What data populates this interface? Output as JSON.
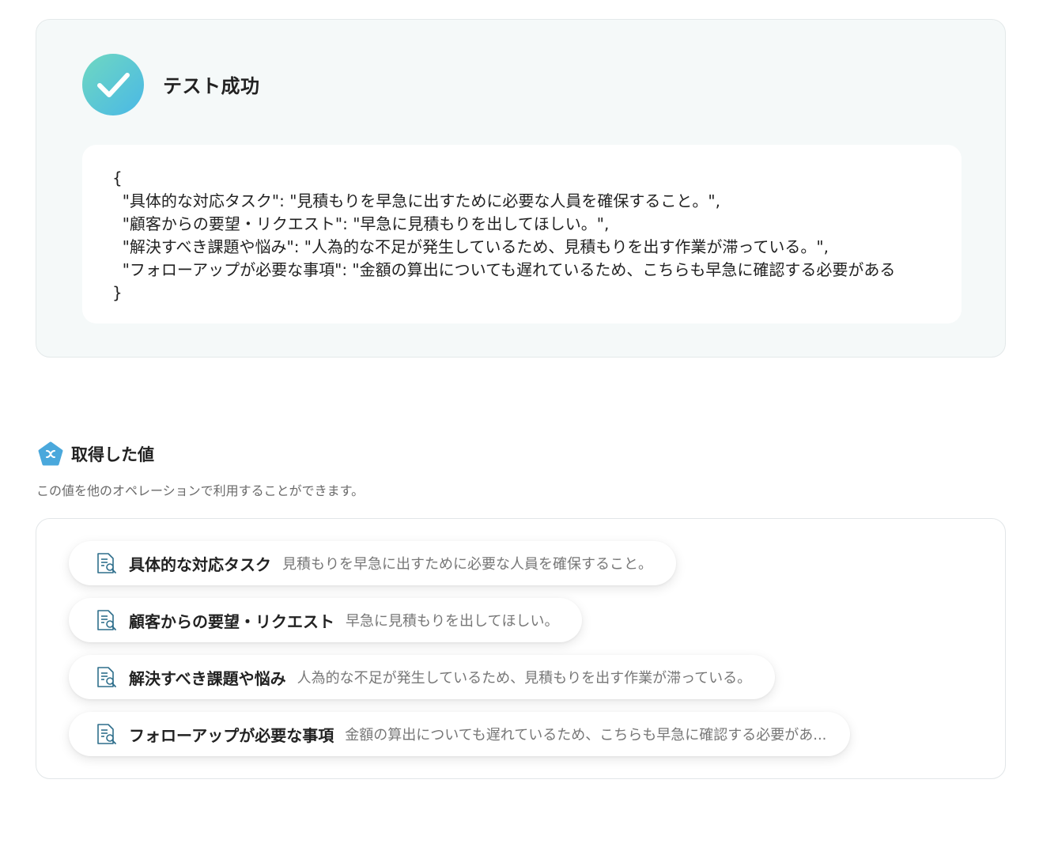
{
  "test_result": {
    "status_label": "テスト成功",
    "json_lines": [
      "{",
      "  \"具体的な対応タスク\": \"見積もりを早急に出すために必要な人員を確保すること。\",",
      "  \"顧客からの要望・リクエスト\": \"早急に見積もりを出してほしい。\",",
      "  \"解決すべき課題や悩み\": \"人為的な不足が発生しているため、見積もりを出す作業が滞っている。\",",
      "  \"フォローアップが必要な事項\": \"金額の算出についても遅れているため、こちらも早急に確認する必要がある",
      "}"
    ]
  },
  "values_section": {
    "title": "取得した値",
    "description": "この値を他のオペレーションで利用することができます。",
    "items": [
      {
        "key": "具体的な対応タスク",
        "value": "見積もりを早急に出すために必要な人員を確保すること。"
      },
      {
        "key": "顧客からの要望・リクエスト",
        "value": "早急に見積もりを出してほしい。"
      },
      {
        "key": "解決すべき課題や悩み",
        "value": "人為的な不足が発生しているため、見積もりを出す作業が滞っている。"
      },
      {
        "key": "フォローアップが必要な事項",
        "value": "金額の算出についても遅れているため、こちらも早急に確認する必要があ..."
      }
    ]
  },
  "icons": {
    "success": "check-icon",
    "section": "variable-badge-icon",
    "item": "document-search-icon"
  },
  "colors": {
    "check_gradient_start": "#6fd8c1",
    "check_gradient_end": "#4ab8e6",
    "badge": "#4aa8dc",
    "item_icon": "#2f6f8c"
  }
}
